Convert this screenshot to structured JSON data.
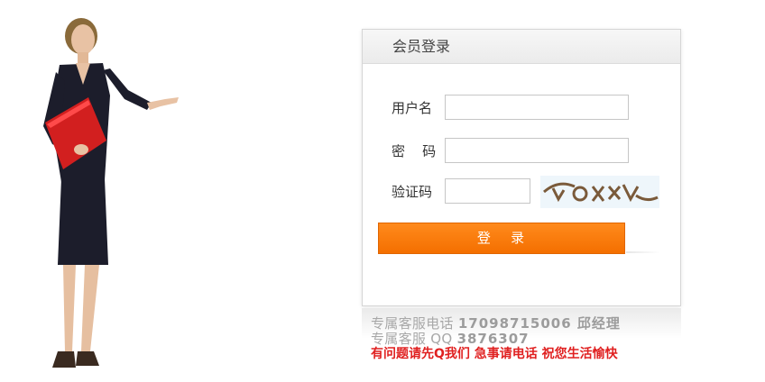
{
  "login_panel": {
    "title": "会员登录",
    "username_label": "用户名",
    "username_value": "",
    "password_label": "密    码",
    "password_value": "",
    "captcha_label": "验证码",
    "captcha_value": "",
    "captcha_image_text": "ɑoxxv",
    "submit_label": "登   录"
  },
  "footer": {
    "phone_prefix": "专属客服电话 ",
    "phone_number": "17098715006",
    "phone_contact": " 邱经理",
    "qq_prefix": "专属客服 QQ  ",
    "qq_number": "3876307",
    "notice": "有问题请先Q我们 急事请电话 祝您生活愉快"
  },
  "colors": {
    "button": "#ff7e00",
    "notice": "#e02020",
    "service_text": "#a8a8a8"
  },
  "illustration": {
    "icon": "businesswoman-illustration"
  }
}
